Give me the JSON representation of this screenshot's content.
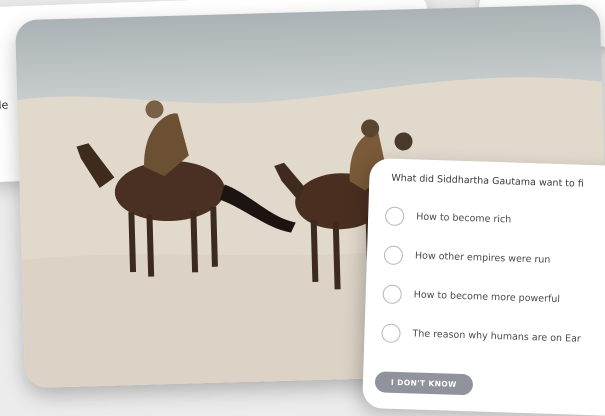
{
  "background_card": {
    "cut_text": "le"
  },
  "photo": {
    "description_icon": "photo-horse-riders-desert"
  },
  "quiz": {
    "question": "What did Siddhartha Gautama want to fi",
    "options": [
      {
        "label": "How to become rich"
      },
      {
        "label": "How other empires were run"
      },
      {
        "label": "How to become more powerful"
      },
      {
        "label": "The reason why humans are on Ear"
      }
    ],
    "dont_know_label": "I DON'T KNOW"
  },
  "colors": {
    "card_bg": "#ffffff",
    "button_bg": "#8f939b",
    "radio_border": "#b7b7b7",
    "sky": "#aab2b5",
    "sand": "#e6ddd2"
  }
}
